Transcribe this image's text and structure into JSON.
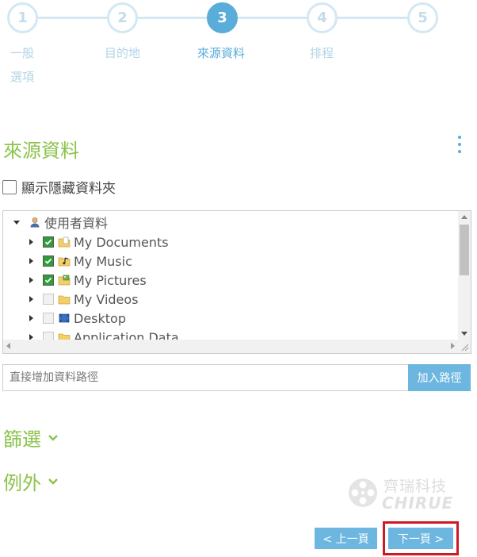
{
  "stepper": {
    "steps": [
      {
        "number": "1",
        "label": "一般選項",
        "state": "inactive"
      },
      {
        "number": "2",
        "label": "目的地",
        "state": "inactive"
      },
      {
        "number": "3",
        "label": "來源資料",
        "state": "active"
      },
      {
        "number": "4",
        "label": "排程",
        "state": "inactive"
      },
      {
        "number": "5",
        "label": "",
        "state": "inactive"
      }
    ]
  },
  "section": {
    "title": "來源資料",
    "menu_icon": "more-vert-icon"
  },
  "hidden_folders": {
    "label": "顯示隱藏資料夾",
    "checked": false
  },
  "tree": {
    "root": {
      "label": "使用者資料",
      "icon": "user-icon",
      "expanded": true
    },
    "items": [
      {
        "label": "My Documents",
        "checked": true,
        "icon": "documents-folder-icon"
      },
      {
        "label": "My Music",
        "checked": true,
        "icon": "music-folder-icon"
      },
      {
        "label": "My Pictures",
        "checked": true,
        "icon": "pictures-folder-icon"
      },
      {
        "label": "My Videos",
        "checked": false,
        "icon": "folder-icon"
      },
      {
        "label": "Desktop",
        "checked": false,
        "icon": "desktop-icon"
      },
      {
        "label": "Application Data",
        "checked": false,
        "icon": "folder-icon"
      }
    ]
  },
  "path_input": {
    "placeholder": "直接增加資料路徑",
    "value": "",
    "button_label": "加入路徑"
  },
  "filters": {
    "label": "篩選"
  },
  "exceptions": {
    "label": "例外"
  },
  "watermark": {
    "cn": "齊瑞科技",
    "en": "CHIRUE"
  },
  "nav": {
    "prev_label": "< 上一頁",
    "next_label": "下一頁 >"
  },
  "colors": {
    "accent_blue": "#5aacd9",
    "button_blue": "#6cb6e0",
    "green": "#8bc34a",
    "highlight_red": "#cc1a22"
  }
}
